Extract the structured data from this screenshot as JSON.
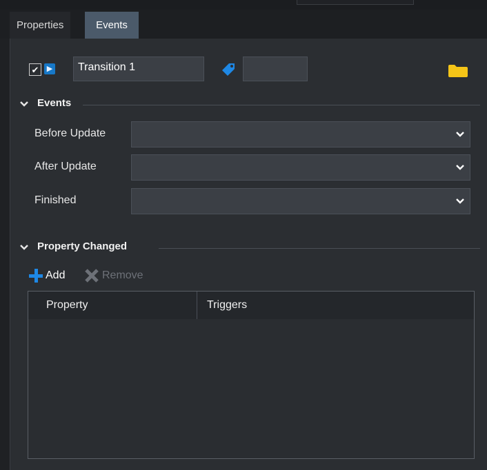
{
  "tabs": [
    {
      "label": "Properties",
      "active": false
    },
    {
      "label": "Events",
      "active": true
    }
  ],
  "object": {
    "enabled": true,
    "type_icon": "transition-node-icon",
    "name": "Transition 1",
    "tag_icon": "tag-icon",
    "tag_value": "",
    "folder_icon": "folder-icon"
  },
  "events_section": {
    "title": "Events",
    "fields": [
      {
        "label": "Before Update",
        "value": ""
      },
      {
        "label": "After Update",
        "value": ""
      },
      {
        "label": "Finished",
        "value": ""
      }
    ]
  },
  "property_changed_section": {
    "title": "Property Changed",
    "add_label": "Add",
    "remove_label": "Remove",
    "columns": [
      "Property",
      "Triggers"
    ],
    "rows": []
  },
  "colors": {
    "accent_blue": "#1e88e5",
    "folder_yellow": "#f5c518",
    "active_tab": "#4b5a6a",
    "panel": "#2b2e32"
  }
}
